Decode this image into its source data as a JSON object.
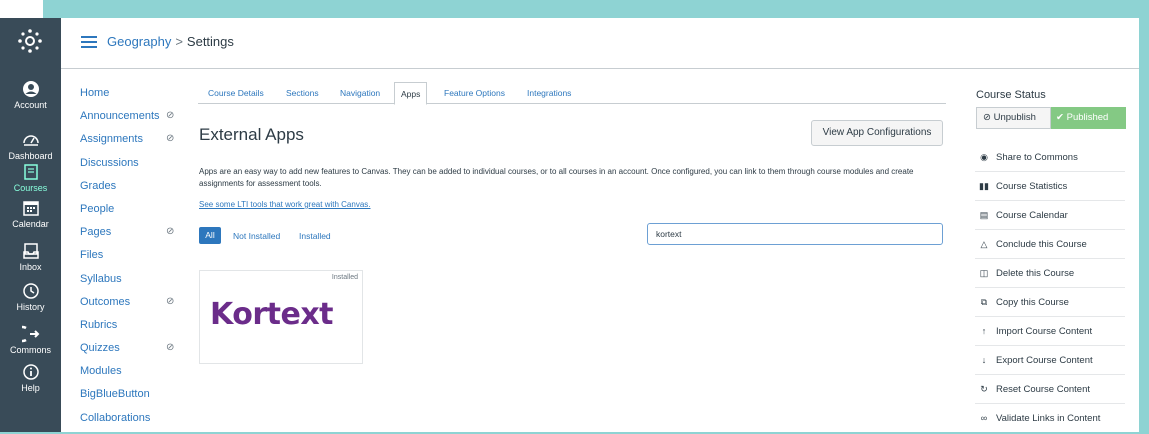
{
  "global_nav": {
    "items": [
      {
        "label": "Account",
        "icon": "account-icon"
      },
      {
        "label": "Dashboard",
        "icon": "dashboard-icon"
      },
      {
        "label": "Courses",
        "icon": "courses-icon"
      },
      {
        "label": "Calendar",
        "icon": "calendar-icon"
      },
      {
        "label": "Inbox",
        "icon": "inbox-icon"
      },
      {
        "label": "History",
        "icon": "history-icon"
      },
      {
        "label": "Commons",
        "icon": "commons-icon"
      },
      {
        "label": "Help",
        "icon": "help-icon"
      }
    ]
  },
  "breadcrumb": {
    "course": "Geography",
    "separator": ">",
    "page": "Settings"
  },
  "course_nav": {
    "items": [
      {
        "label": "Home"
      },
      {
        "label": "Announcements"
      },
      {
        "label": "Assignments"
      },
      {
        "label": "Discussions"
      },
      {
        "label": "Grades"
      },
      {
        "label": "People"
      },
      {
        "label": "Pages"
      },
      {
        "label": "Files"
      },
      {
        "label": "Syllabus"
      },
      {
        "label": "Outcomes"
      },
      {
        "label": "Rubrics"
      },
      {
        "label": "Quizzes"
      },
      {
        "label": "Modules"
      },
      {
        "label": "BigBlueButton"
      },
      {
        "label": "Collaborations"
      }
    ]
  },
  "tabs": [
    {
      "label": "Course Details"
    },
    {
      "label": "Sections"
    },
    {
      "label": "Navigation"
    },
    {
      "label": "Apps"
    },
    {
      "label": "Feature Options"
    },
    {
      "label": "Integrations"
    }
  ],
  "main": {
    "title": "External Apps",
    "view_button": "View App Configurations",
    "description": "Apps are an easy way to add new features to Canvas. They can be added to individual courses, or to all courses in an account. Once configured, you can link to them through course modules and create assignments for assessment tools.",
    "lti_link": "See some LTI tools that work great with Canvas.",
    "filters": {
      "all": "All",
      "not_installed": "Not Installed",
      "installed": "Installed"
    },
    "search_value": "kortext",
    "app_card": {
      "status": "Installed",
      "logo_text": "Kortext"
    }
  },
  "sidebar": {
    "title": "Course Status",
    "unpublish": "Unpublish",
    "published": "Published",
    "items": [
      {
        "label": "Share to Commons",
        "icon": "share-icon"
      },
      {
        "label": "Course Statistics",
        "icon": "stats-icon"
      },
      {
        "label": "Course Calendar",
        "icon": "calendar-icon"
      },
      {
        "label": "Conclude this Course",
        "icon": "lock-icon"
      },
      {
        "label": "Delete this Course",
        "icon": "trash-icon"
      },
      {
        "label": "Copy this Course",
        "icon": "copy-icon"
      },
      {
        "label": "Import Course Content",
        "icon": "upload-icon"
      },
      {
        "label": "Export Course Content",
        "icon": "download-icon"
      },
      {
        "label": "Reset Course Content",
        "icon": "reset-icon"
      },
      {
        "label": "Validate Links in Content",
        "icon": "link-icon"
      }
    ]
  },
  "colors": {
    "nav_bg": "#394b58",
    "link": "#2d77bd",
    "published": "#5cb85c",
    "brand_purple": "#6b2c8a",
    "frame": "#8ed3d3"
  }
}
